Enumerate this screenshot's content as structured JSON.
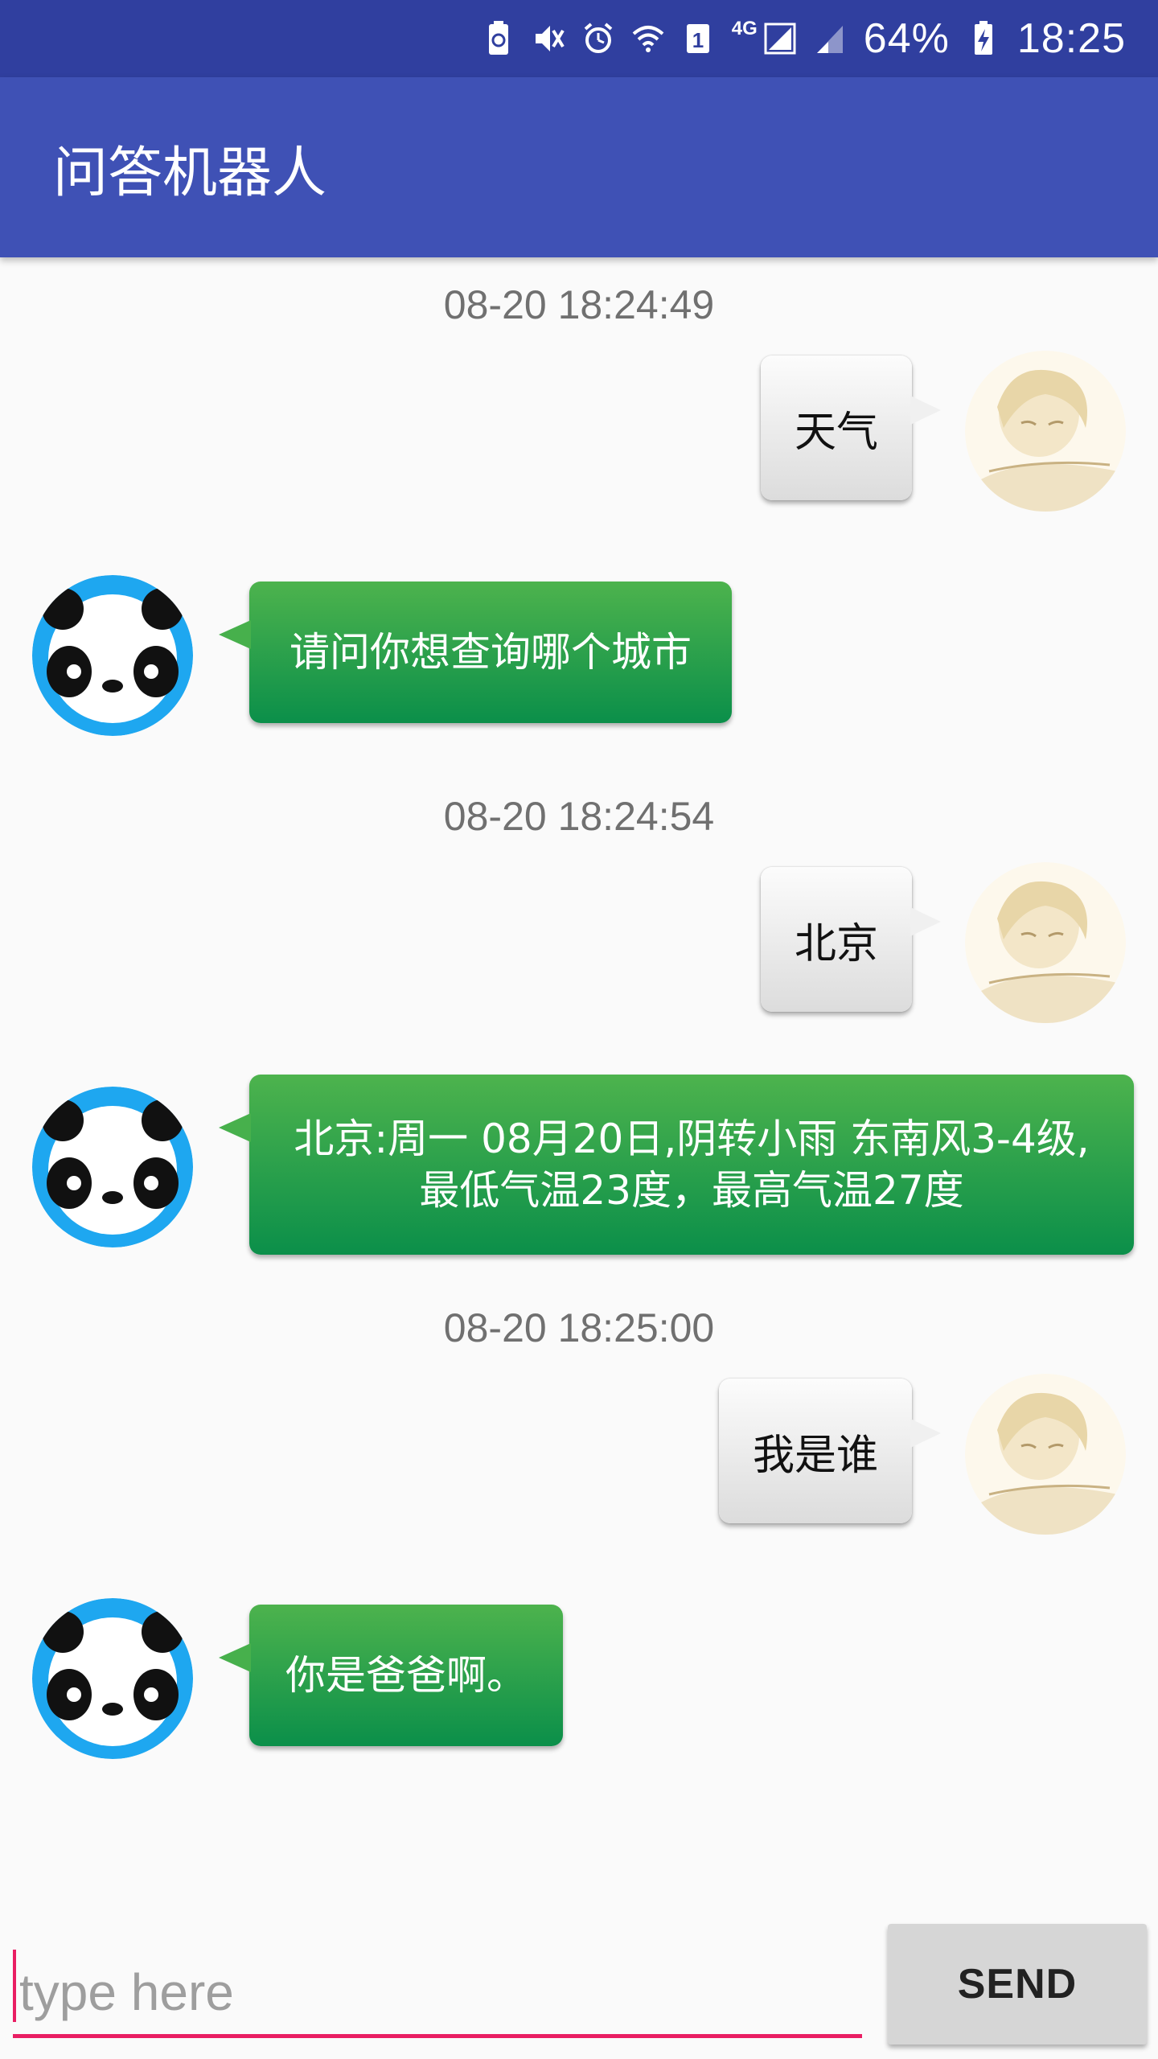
{
  "status_bar": {
    "network": "4G",
    "battery": "64%",
    "time": "18:25",
    "icons": [
      "battery-saver-icon",
      "mute-icon",
      "alarm-icon",
      "wifi-icon",
      "sim-icon",
      "signal-icon",
      "signal-weak-icon",
      "battery-charging-icon"
    ]
  },
  "app_bar": {
    "title": "问答机器人"
  },
  "messages": [
    {
      "timestamp": "08-20 18:24:49",
      "from": "user",
      "text": "天气"
    },
    {
      "from": "bot",
      "text": "请问你想查询哪个城市"
    },
    {
      "timestamp": "08-20 18:24:54",
      "from": "user",
      "text": "北京"
    },
    {
      "from": "bot",
      "lines": [
        "北京:周一 08月20日,阴转小雨 东南风3-4级,",
        "最低气温23度，最高气温27度"
      ]
    },
    {
      "timestamp": "08-20 18:25:00",
      "from": "user",
      "text": "我是谁"
    },
    {
      "from": "bot",
      "text": "你是爸爸啊。"
    }
  ],
  "input": {
    "placeholder": "type here",
    "value": ""
  },
  "send_button": {
    "label": "SEND"
  },
  "colors": {
    "status_bar": "#303f9f",
    "app_bar": "#3f51b5",
    "bot_bubble": "#1a9a4c",
    "accent": "#e91e63",
    "bot_avatar_ring": "#1ea7f0"
  }
}
